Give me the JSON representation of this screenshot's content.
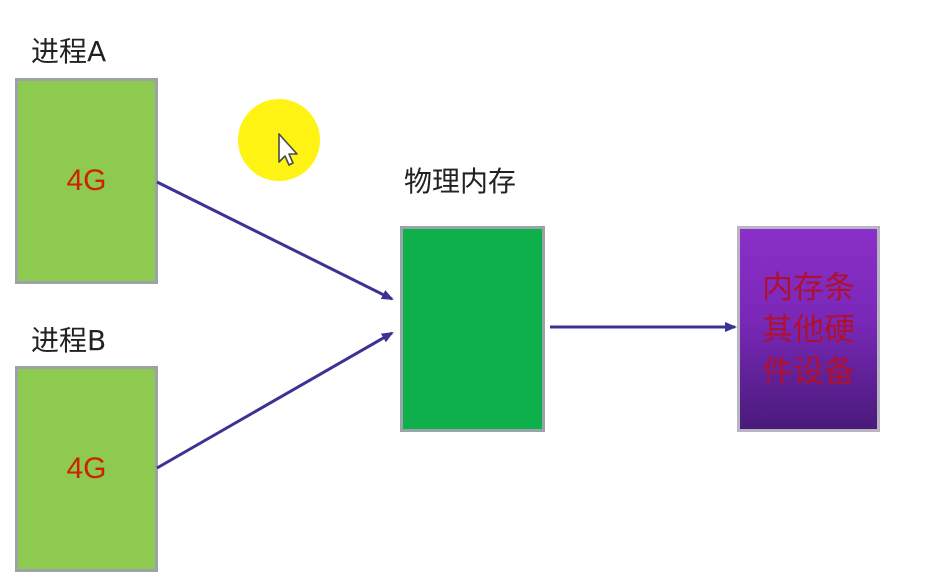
{
  "diagram": {
    "process_a": {
      "label": "进程A",
      "size": "4G"
    },
    "process_b": {
      "label": "进程B",
      "size": "4G"
    },
    "physical_memory": {
      "label": "物理内存"
    },
    "hardware": {
      "text": "内存条其他硬件设备"
    }
  },
  "colors": {
    "process_fill": "#8ec950",
    "size_text": "#cc2200",
    "memory_fill": "#0db04b",
    "hardware_fill": "#7a28b8",
    "hardware_text": "#b01030",
    "arrow": "#3b3394",
    "cursor_highlight": "#fff200"
  },
  "icons": {
    "cursor": "mouse-pointer-icon"
  }
}
